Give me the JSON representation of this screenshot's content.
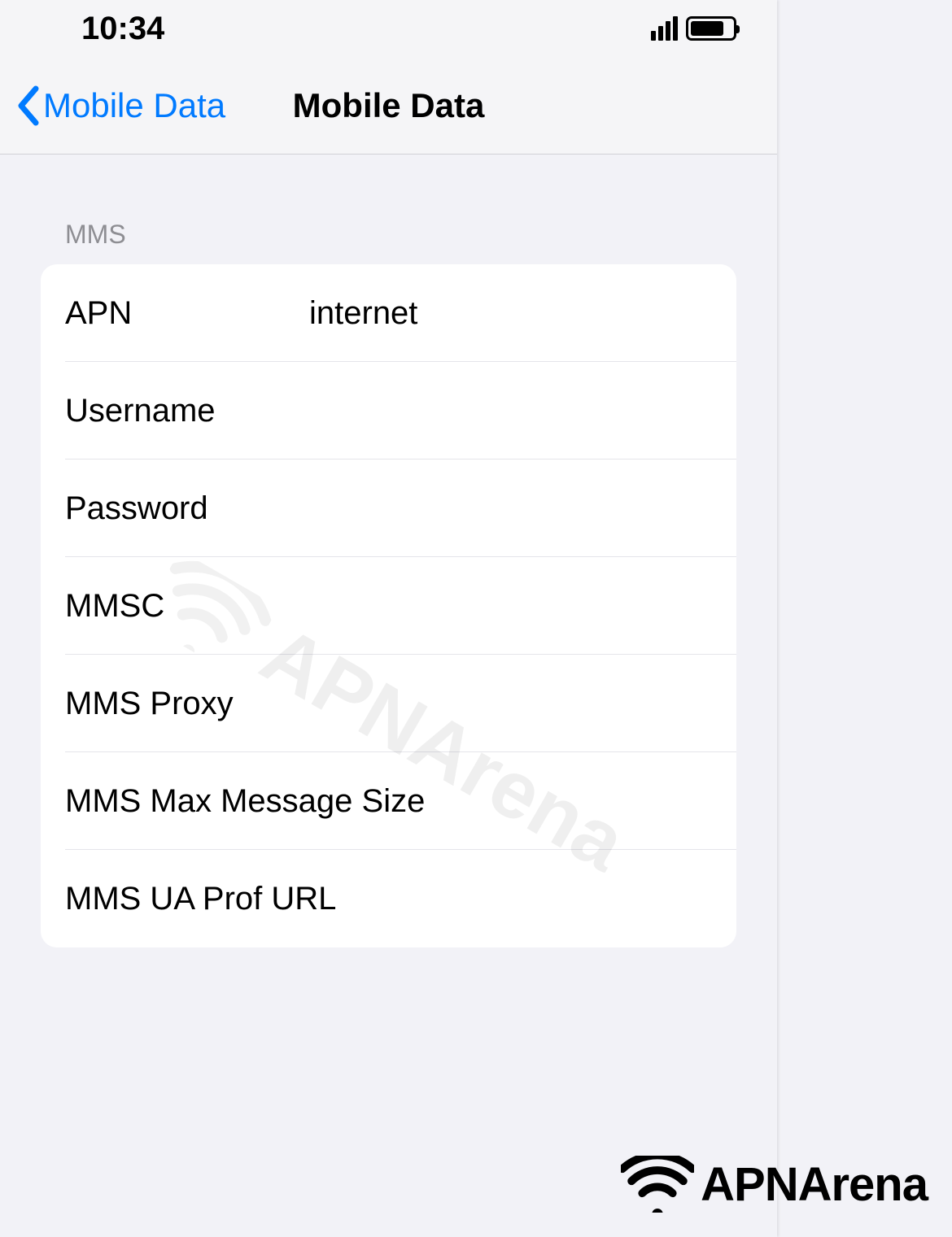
{
  "status_bar": {
    "time": "10:34"
  },
  "nav": {
    "back_label": "Mobile Data",
    "title": "Mobile Data"
  },
  "section": {
    "header": "MMS"
  },
  "fields": {
    "apn_label": "APN",
    "apn_value": "internet",
    "username_label": "Username",
    "username_value": "",
    "password_label": "Password",
    "password_value": "",
    "mmsc_label": "MMSC",
    "mmsc_value": "",
    "mms_proxy_label": "MMS Proxy",
    "mms_proxy_value": "",
    "mms_max_label": "MMS Max Message Size",
    "mms_max_value": "",
    "mms_ua_label": "MMS UA Prof URL",
    "mms_ua_value": ""
  },
  "watermark": {
    "text": "APNArena"
  },
  "footer": {
    "brand": "APNArena"
  }
}
